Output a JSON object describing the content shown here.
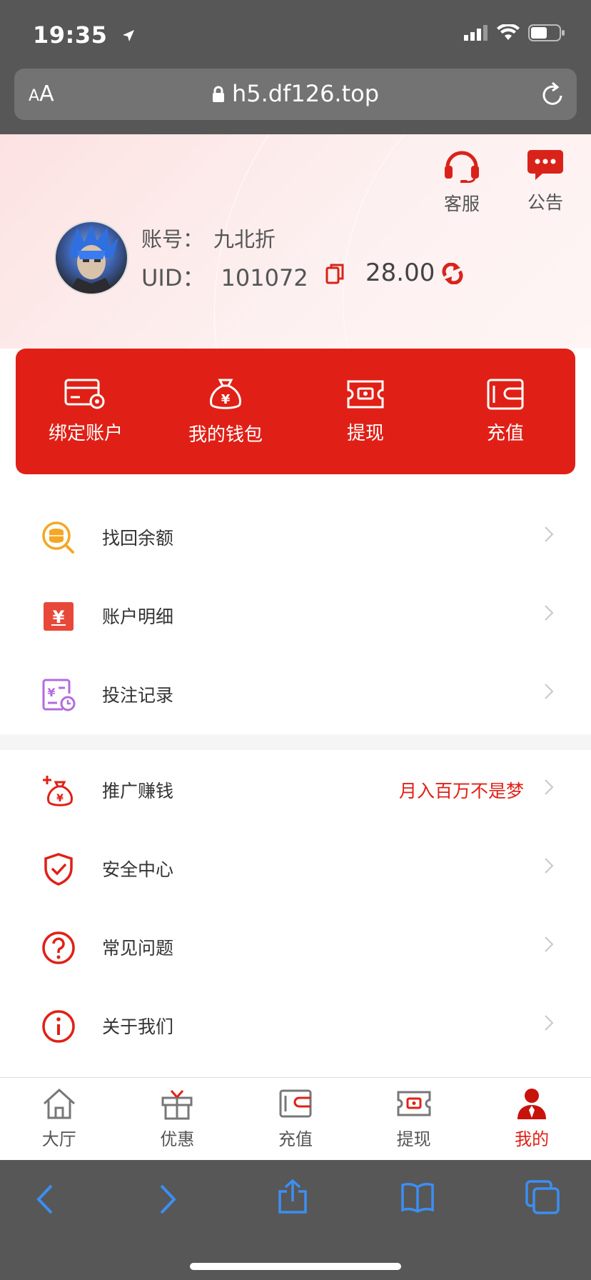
{
  "status": {
    "time": "19:35"
  },
  "browser": {
    "aa_small": "A",
    "aa_large": "A",
    "url": "h5.df126.top"
  },
  "header": {
    "service_label": "客服",
    "notice_label": "公告",
    "account_label": "账号：",
    "account_value": "九北折",
    "uid_label": "UID：",
    "uid_value": "101072",
    "balance": "28.00"
  },
  "actions": [
    {
      "label": "绑定账户",
      "icon": "bind-account-icon"
    },
    {
      "label": "我的钱包",
      "icon": "wallet-bag-icon"
    },
    {
      "label": "提现",
      "icon": "withdraw-icon"
    },
    {
      "label": "充值",
      "icon": "recharge-icon"
    }
  ],
  "menu_group1": [
    {
      "label": "找回余额",
      "icon": "coin-search-icon",
      "color": "#f5a623"
    },
    {
      "label": "账户明细",
      "icon": "account-detail-icon",
      "color": "#e8483a"
    },
    {
      "label": "投注记录",
      "icon": "bet-record-icon",
      "color": "#b36be0"
    }
  ],
  "menu_group2": [
    {
      "label": "推广赚钱",
      "icon": "promotion-icon",
      "extra": "月入百万不是梦",
      "color": "#e02016"
    },
    {
      "label": "安全中心",
      "icon": "security-shield-icon",
      "color": "#e02016"
    },
    {
      "label": "常见问题",
      "icon": "question-icon",
      "color": "#e02016"
    },
    {
      "label": "关于我们",
      "icon": "info-icon",
      "color": "#e02016"
    }
  ],
  "tabs": [
    {
      "label": "大厅",
      "icon": "home-icon"
    },
    {
      "label": "优惠",
      "icon": "gift-icon"
    },
    {
      "label": "充值",
      "icon": "recharge-icon"
    },
    {
      "label": "提现",
      "icon": "withdraw-icon"
    },
    {
      "label": "我的",
      "icon": "user-icon",
      "active": true
    }
  ],
  "colors": {
    "brand_red": "#e02016",
    "browser_gray": "#575757",
    "ios_blue": "#3b8ff3"
  }
}
